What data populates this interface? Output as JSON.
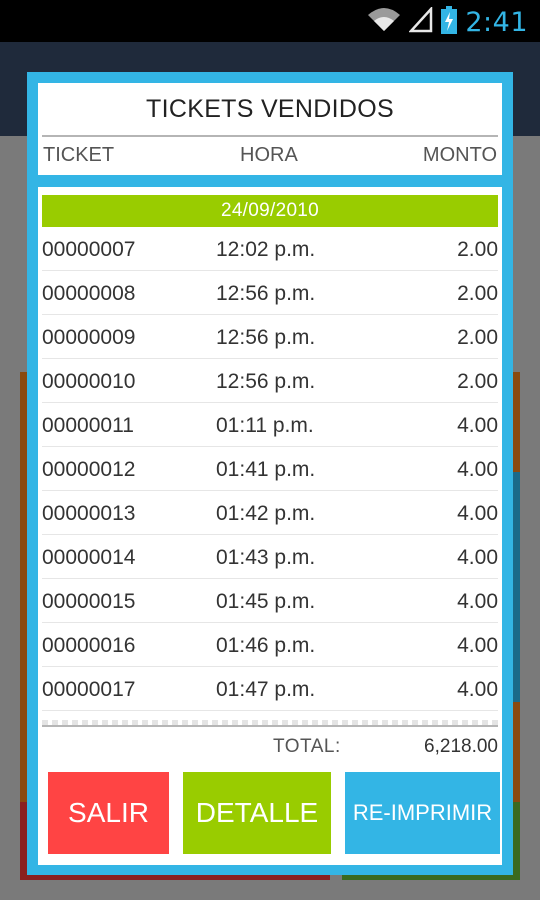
{
  "status_bar": {
    "time": "2:41",
    "icons": [
      "wifi-icon",
      "signal-icon",
      "battery-charging-icon"
    ],
    "time_color": "#33b5e5"
  },
  "dialog": {
    "title": "TICKETS VENDIDOS",
    "columns": {
      "ticket": "TICKET",
      "hora": "HORA",
      "monto": "MONTO"
    },
    "date": "24/09/2010",
    "rows": [
      {
        "ticket": "00000007",
        "hora": "12:02 p.m.",
        "monto": "2.00"
      },
      {
        "ticket": "00000008",
        "hora": "12:56 p.m.",
        "monto": "2.00"
      },
      {
        "ticket": "00000009",
        "hora": "12:56 p.m.",
        "monto": "2.00"
      },
      {
        "ticket": "00000010",
        "hora": "12:56 p.m.",
        "monto": "2.00"
      },
      {
        "ticket": "00000011",
        "hora": "01:11 p.m.",
        "monto": "4.00"
      },
      {
        "ticket": "00000012",
        "hora": "01:41 p.m.",
        "monto": "4.00"
      },
      {
        "ticket": "00000013",
        "hora": "01:42 p.m.",
        "monto": "4.00"
      },
      {
        "ticket": "00000014",
        "hora": "01:43 p.m.",
        "monto": "4.00"
      },
      {
        "ticket": "00000015",
        "hora": "01:45 p.m.",
        "monto": "4.00"
      },
      {
        "ticket": "00000016",
        "hora": "01:46 p.m.",
        "monto": "4.00"
      },
      {
        "ticket": "00000017",
        "hora": "01:47 p.m.",
        "monto": "4.00"
      }
    ],
    "total_label": "TOTAL:",
    "total_value": "6,218.00",
    "buttons": {
      "salir": "SALIR",
      "detalle": "DETALLE",
      "reimprimir": "RE-IMPRIMIR"
    }
  },
  "colors": {
    "accent_blue": "#33b5e5",
    "accent_green": "#99cc00",
    "accent_red": "#ff4444"
  }
}
